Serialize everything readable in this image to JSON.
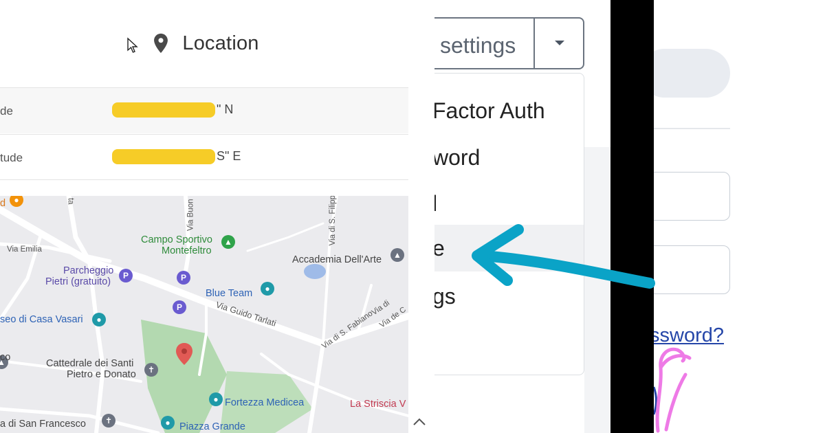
{
  "location_panel": {
    "title": "Location",
    "rows": [
      {
        "label": "de",
        "value_suffix": "\" N"
      },
      {
        "label": "tude",
        "value_suffix": "S\" E"
      }
    ],
    "map_labels": {
      "campo_sportivo": "Campo Sportivo\nMontefeltro",
      "campo_sportivo_line1": "Campo Sportivo",
      "campo_sportivo_line2": "Montefeltro",
      "accademia": "Accademia Dell'Arte",
      "parcheggio_line1": "Parcheggio",
      "parcheggio_line2": "Pietri (gratuito)",
      "blue_team": "Blue Team",
      "via_guido": "Via Guido Tarlati",
      "casa_vasari": "seo di Casa Vasari",
      "cattedrale_line1": "Cattedrale dei Santi",
      "cattedrale_line2": "Pietro e Donato",
      "fortezza": "Fortezza Medicea",
      "striscia": "La Striscia V",
      "san_francesco": "a di San Francesco",
      "piazza_grande": "Piazza Grande",
      "via_emilia": "Via Emilia",
      "via_buon": "Via Buon",
      "via_s_filippo": "Via di S. Filipp",
      "via_s_fabiano": "Via di S. Fabiano",
      "via_de_c": "Via de C",
      "via_di": "Via di",
      "co": "co",
      "ta": "ta",
      "d": "d"
    }
  },
  "settings_panel": {
    "button_label": "settings",
    "menu_items": [
      "Factor Auth",
      "word",
      "l",
      "e",
      "gs"
    ],
    "highlighted_index": 3
  },
  "login_panel": {
    "forgot_link": "ssword?"
  },
  "colors": {
    "annotation_arrow": "#0aa3c7",
    "annotation_pink": "#ee7ae6",
    "redaction": "#f5c91b",
    "link": "#2546a8"
  },
  "icons": [
    "map-pin-icon",
    "mouse-cursor-icon",
    "dropdown-caret-icon",
    "chevron-up-icon"
  ]
}
